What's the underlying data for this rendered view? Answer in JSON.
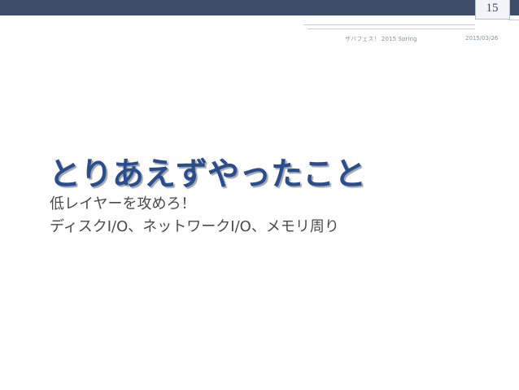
{
  "slide": {
    "page_number": "15",
    "footer_event": "ザバフェス！ 2015 Spring",
    "footer_date": "2015/03/26",
    "title": "とりあえずやったこと",
    "body_lines": [
      "低レイヤーを攻めろ！",
      "ディスクI/O、ネットワークI/O、メモリ周り"
    ]
  },
  "colors": {
    "top_bar": "#3d4c67",
    "title": "#2a4d8e",
    "body_text": "#4a4a4a",
    "footer_text": "#8792a5"
  }
}
